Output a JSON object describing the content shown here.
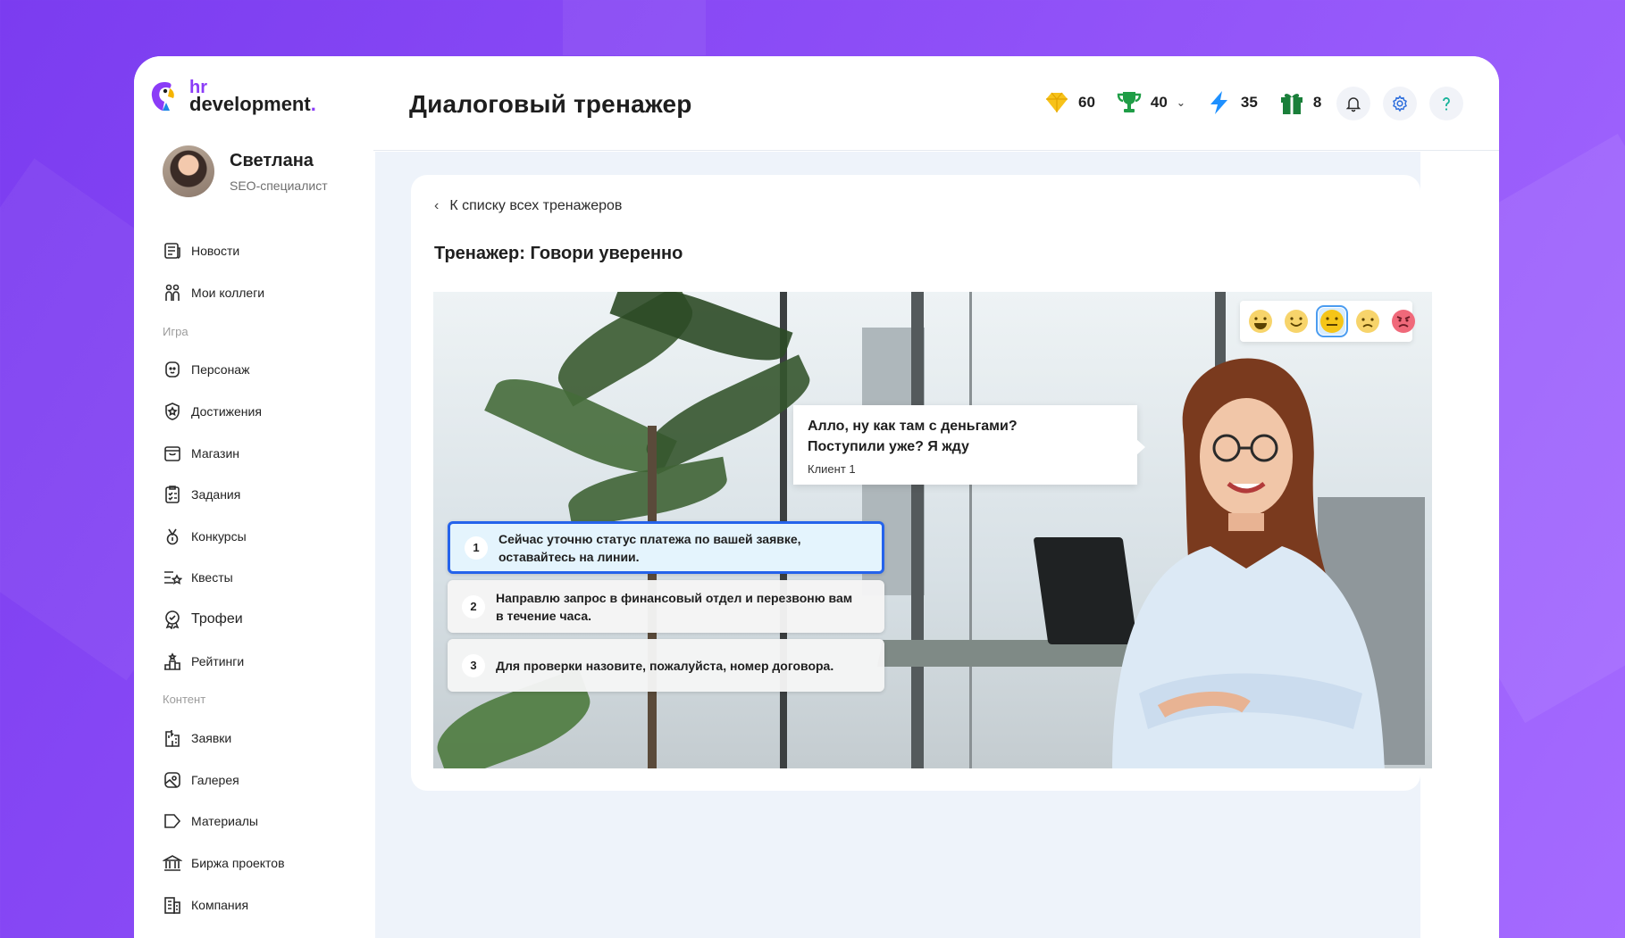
{
  "app": {
    "logo_hr": "hr",
    "logo_dev": "development",
    "logo_dot": "."
  },
  "profile": {
    "name": "Светлана",
    "role": "SEO-специалист"
  },
  "sidebar": {
    "items": [
      {
        "label": "Новости",
        "icon": "newspaper-icon"
      },
      {
        "label": "Мои коллеги",
        "icon": "people-icon"
      },
      {
        "section": "Игра"
      },
      {
        "label": "Персонаж",
        "icon": "character-icon"
      },
      {
        "label": "Достижения",
        "icon": "shield-star-icon"
      },
      {
        "label": "Магазин",
        "icon": "shop-icon"
      },
      {
        "label": "Задания",
        "icon": "checklist-icon"
      },
      {
        "label": "Конкурсы",
        "icon": "medal-icon"
      },
      {
        "label": "Квесты",
        "icon": "quest-icon"
      },
      {
        "label": "Трофеи",
        "icon": "trophy-badge-icon"
      },
      {
        "label": "Рейтинги",
        "icon": "podium-icon"
      },
      {
        "section": "Контент"
      },
      {
        "label": "Заявки",
        "icon": "requests-icon"
      },
      {
        "label": "Галерея",
        "icon": "gallery-icon"
      },
      {
        "label": "Материалы",
        "icon": "tag-icon"
      },
      {
        "label": "Биржа проектов",
        "icon": "bank-icon"
      },
      {
        "label": "Компания",
        "icon": "building-icon"
      }
    ]
  },
  "header": {
    "title": "Диалоговый тренажер",
    "stats": {
      "diamonds": "60",
      "trophies": "40",
      "energy": "35",
      "gifts": "8"
    }
  },
  "trainer": {
    "back_label": "К списку всех тренажеров",
    "title": "Тренажер: Говори уверенно",
    "bubble_line1": "Алло, ну как там с деньгами?",
    "bubble_line2": "Поступили уже? Я жду",
    "bubble_speaker": "Клиент 1",
    "emotions": [
      "very-happy",
      "happy",
      "neutral",
      "sad",
      "angry"
    ],
    "selected_emotion": "neutral",
    "answers": [
      {
        "num": "1",
        "line1": "Сейчас уточню статус платежа по вашей заявке,",
        "line2": "оставайтесь на линии.",
        "active": true
      },
      {
        "num": "2",
        "line1": "Направлю запрос в финансовый отдел и перезвоню вам",
        "line2": "в течение часа.",
        "active": false
      },
      {
        "num": "3",
        "line1": "Для проверки назовите, пожалуйста, номер договора.",
        "line2": "",
        "active": false
      }
    ]
  },
  "colors": {
    "accent": "#8b3cf7",
    "selected_answer_border": "#2563eb",
    "main_bg": "#eef3fa"
  }
}
